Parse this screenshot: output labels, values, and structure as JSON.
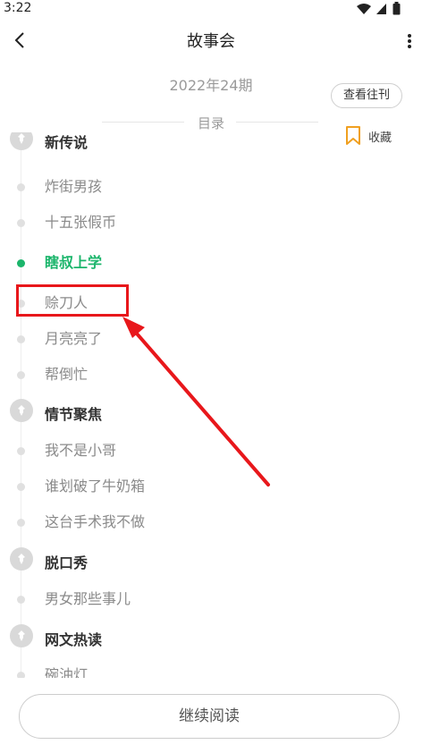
{
  "status": {
    "time": "3:22"
  },
  "header": {
    "title": "故事会"
  },
  "issue": {
    "label": "2022年24期",
    "past_button": "查看往刊",
    "toc_label": "目录",
    "favorite_label": "收藏"
  },
  "toc": {
    "section1": {
      "title": "新传说"
    },
    "items1": [
      "炸街男孩",
      "十五张假币",
      "瞎叔上学",
      "赊刀人",
      "月亮亮了",
      "帮倒忙"
    ],
    "section2": {
      "title": "情节聚焦"
    },
    "items2": [
      "我不是小哥",
      "谁划破了牛奶箱",
      "这台手术我不做"
    ],
    "section3": {
      "title": "脱口秀"
    },
    "items3": [
      "男女那些事儿"
    ],
    "section4": {
      "title": "网文热读"
    },
    "items4": [
      "碗油灯"
    ]
  },
  "footer": {
    "continue_label": "继续阅读"
  },
  "colors": {
    "accent": "#1bb56b",
    "annotation": "#e8171b"
  }
}
